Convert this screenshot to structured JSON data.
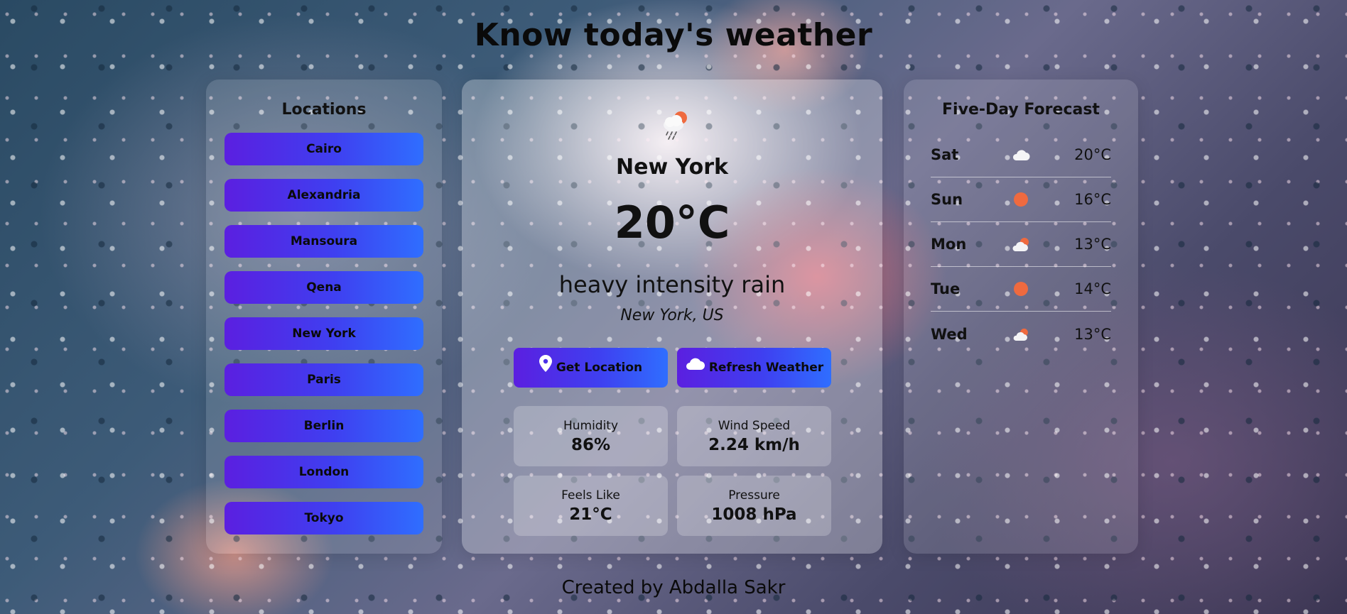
{
  "header": {
    "title": "Know today's weather"
  },
  "locations": {
    "title": "Locations",
    "items": [
      "Cairo",
      "Alexandria",
      "Mansoura",
      "Qena",
      "New York",
      "Paris",
      "Berlin",
      "London",
      "Tokyo"
    ]
  },
  "current": {
    "icon": "rain-sun-icon",
    "city": "New York",
    "temperature": "20°C",
    "description": "heavy intensity rain",
    "location": "New York, US",
    "get_location_label": "Get Location",
    "refresh_label": "Refresh Weather",
    "stats": {
      "humidity_label": "Humidity",
      "humidity_value": "86%",
      "wind_label": "Wind Speed",
      "wind_value": "2.24 km/h",
      "feels_label": "Feels Like",
      "feels_value": "21°C",
      "pressure_label": "Pressure",
      "pressure_value": "1008 hPa"
    }
  },
  "forecast": {
    "title": "Five-Day Forecast",
    "days": [
      {
        "day": "Sat",
        "icon": "cloud-icon",
        "temp": "20°C"
      },
      {
        "day": "Sun",
        "icon": "sun-icon",
        "temp": "16°C"
      },
      {
        "day": "Mon",
        "icon": "cloud-sun-icon",
        "temp": "13°C"
      },
      {
        "day": "Tue",
        "icon": "sun-icon",
        "temp": "14°C"
      },
      {
        "day": "Wed",
        "icon": "cloud-sun-icon",
        "temp": "13°C"
      }
    ]
  },
  "footer": {
    "text": "Created by Abdalla Sakr"
  },
  "colors": {
    "button_start": "#5b1fe0",
    "button_end": "#2f6eff",
    "sun": "#ef6a3f"
  }
}
